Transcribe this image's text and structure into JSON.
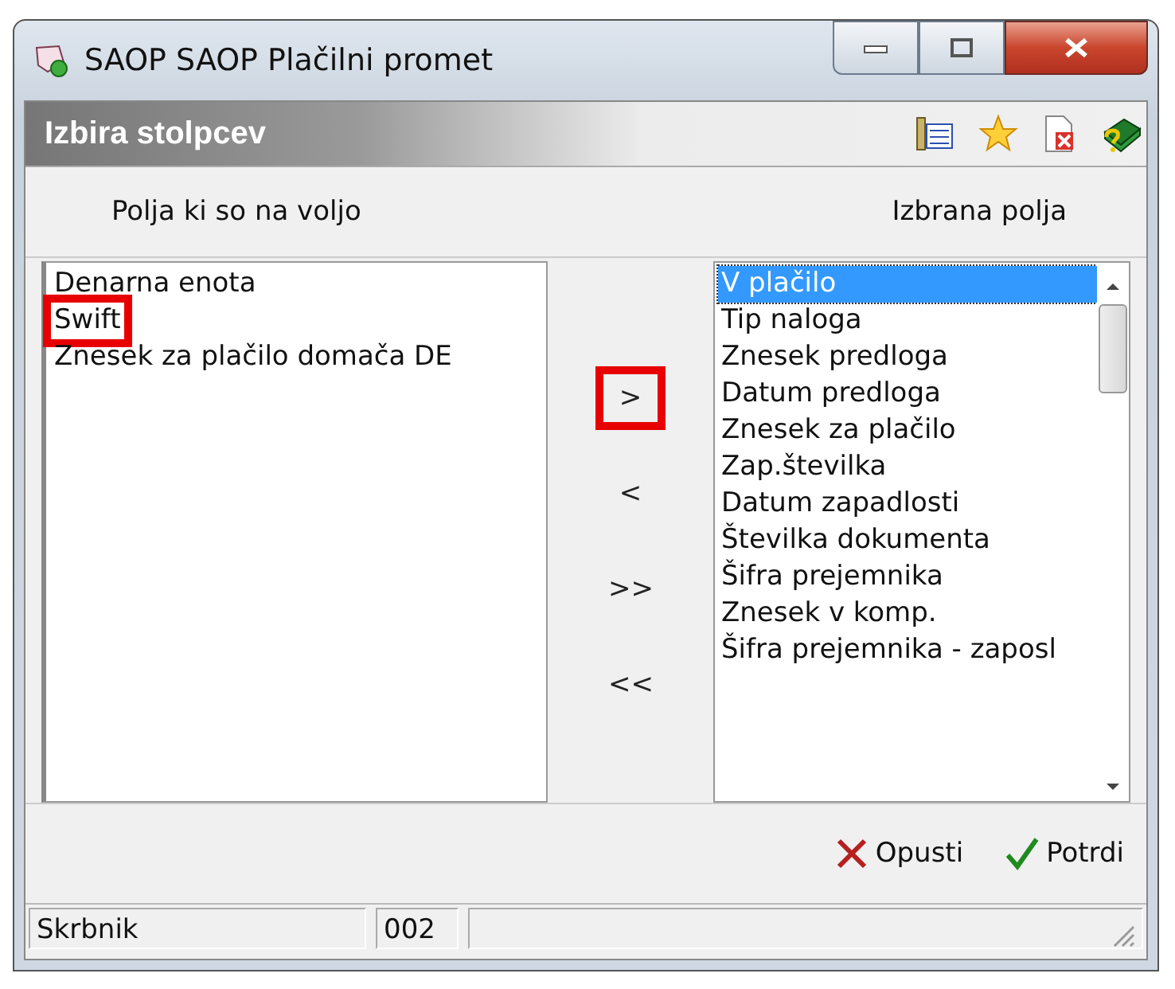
{
  "window": {
    "title": "SAOP SAOP Plačilni promet"
  },
  "panel": {
    "title": "Izbira stolpcev"
  },
  "available": {
    "heading": "Polja ki so na voljo",
    "items": [
      {
        "label": "Denarna enota",
        "selected": false,
        "highlighted": false
      },
      {
        "label": "Swift",
        "selected": false,
        "highlighted": true
      },
      {
        "label": "Znesek za plačilo domača DE",
        "selected": false,
        "highlighted": false
      }
    ]
  },
  "move_buttons": [
    {
      "label": ">",
      "highlighted": true
    },
    {
      "label": "<",
      "highlighted": false
    },
    {
      "label": ">>",
      "highlighted": false
    },
    {
      "label": "<<",
      "highlighted": false
    }
  ],
  "chosen": {
    "heading": "Izbrana polja",
    "items": [
      {
        "label": "V plačilo",
        "selected": true
      },
      {
        "label": "Tip naloga",
        "selected": false
      },
      {
        "label": "Znesek predloga",
        "selected": false
      },
      {
        "label": "Datum predloga",
        "selected": false
      },
      {
        "label": "Znesek za plačilo",
        "selected": false
      },
      {
        "label": "Zap.številka",
        "selected": false
      },
      {
        "label": "Datum zapadlosti",
        "selected": false
      },
      {
        "label": "Številka dokumenta",
        "selected": false
      },
      {
        "label": "Šifra prejemnika",
        "selected": false
      },
      {
        "label": "Znesek v komp.",
        "selected": false
      },
      {
        "label": "Šifra prejemnika - zaposl",
        "selected": false
      }
    ]
  },
  "actions": [
    {
      "kind": "cancel",
      "label": "Opusti"
    },
    {
      "kind": "confirm",
      "label": "Potrdi"
    }
  ],
  "status_bar": [
    "Skrbnik",
    "002"
  ]
}
